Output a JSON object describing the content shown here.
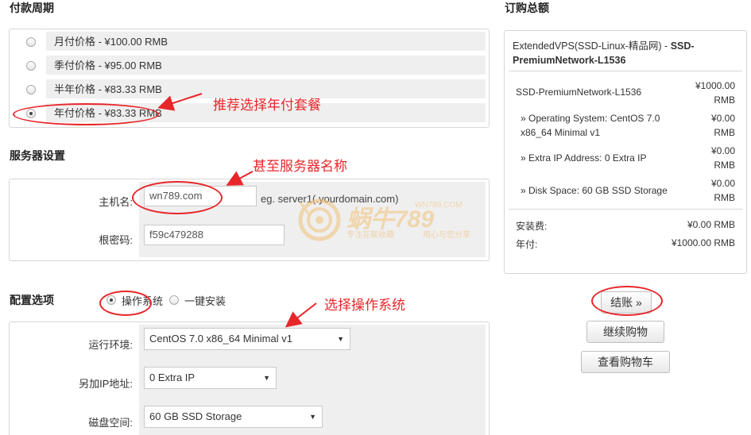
{
  "billing": {
    "title": "付款周期",
    "options": [
      {
        "label": "月付价格 - ¥100.00 RMB",
        "checked": false
      },
      {
        "label": "季付价格 - ¥95.00 RMB",
        "checked": false
      },
      {
        "label": "半年价格 - ¥83.33 RMB",
        "checked": false
      },
      {
        "label": "年付价格 - ¥83.33 RMB",
        "checked": true
      }
    ],
    "annotation": "推荐选择年付套餐"
  },
  "server": {
    "title": "服务器设置",
    "hostname_label": "主机名:",
    "hostname_value": "wn789.com",
    "hostname_hint": "eg. server1(.yourdomain.com)",
    "rootpw_label": "根密码:",
    "rootpw_value": "f59c479288",
    "annotation": "甚至服务器名称"
  },
  "config": {
    "title": "配置选项",
    "tab_os": "操作系统",
    "tab_oneclick": "一键安装",
    "annotation": "选择操作系统",
    "os_label": "运行环境:",
    "os_value": "CentOS 7.0 x86_64 Minimal v1",
    "ip_label": "另加IP地址:",
    "ip_value": "0 Extra IP",
    "disk_label": "磁盘空间:",
    "disk_value": "60 GB SSD Storage"
  },
  "summary": {
    "title": "订购总额",
    "product_name": "ExtendedVPS(SSD-Linux-精品网) - ",
    "product_plan": "SSD-PremiumNetwork-L1536",
    "plan_line": "SSD-PremiumNetwork-L1536",
    "plan_price": "¥1000.00 RMB",
    "items": [
      {
        "label": "» Operating System: CentOS 7.0 x86_64 Minimal v1",
        "price": "¥0.00 RMB"
      },
      {
        "label": "» Extra IP Address: 0 Extra IP",
        "price": "¥0.00 RMB"
      },
      {
        "label": "» Disk Space: 60 GB SSD Storage",
        "price": "¥0.00 RMB"
      }
    ],
    "setup_label": "安装费:",
    "setup_value": "¥0.00 RMB",
    "annual_label": "年付:",
    "annual_value": "¥1000.00 RMB"
  },
  "buttons": {
    "checkout": "结账 »",
    "continue": "继续购物",
    "view_cart": "查看购物车"
  },
  "watermark": {
    "brand": "蜗牛789",
    "domain": "WN789.COM",
    "slogan1": "专注互联收藏",
    "slogan2": "用心与您分享"
  },
  "colors": {
    "annotation_red": "#e8262a",
    "panel_gray": "#efefef",
    "border": "#d6d6d6"
  }
}
